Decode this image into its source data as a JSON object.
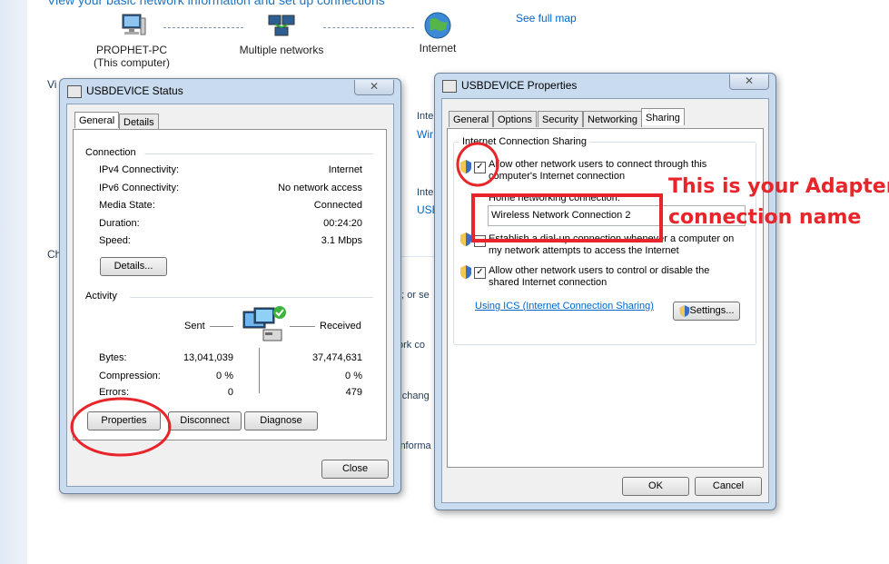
{
  "background": {
    "top_text": "View your basic network information and set up connections",
    "see_full_map": "See full map",
    "nodes": [
      {
        "name": "PROPHET-PC",
        "sub": "(This computer)"
      },
      {
        "name": "Multiple networks",
        "sub": ""
      },
      {
        "name": "Internet",
        "sub": ""
      }
    ],
    "fragments": {
      "vi": "Vi",
      "ch": "Ch",
      "inte1": "Inte",
      "wir": "Wir",
      "inte2": "Inte",
      "usb": "USB",
      "on_or_se": "n; or se",
      "ork_co": "ork co",
      "r_change": "r chang",
      "informa": "informa"
    }
  },
  "status_window": {
    "title": "USBDEVICE Status",
    "close_glyph": "✕",
    "tabs": [
      "General",
      "Details"
    ],
    "connection_label": "Connection",
    "rows": [
      {
        "label": "IPv4 Connectivity:",
        "value": "Internet"
      },
      {
        "label": "IPv6 Connectivity:",
        "value": "No network access"
      },
      {
        "label": "Media State:",
        "value": "Connected"
      },
      {
        "label": "Duration:",
        "value": "00:24:20"
      },
      {
        "label": "Speed:",
        "value": "3.1 Mbps"
      }
    ],
    "details_button": "Details...",
    "activity_label": "Activity",
    "sent_label": "Sent",
    "received_label": "Received",
    "activity_rows": [
      {
        "label": "Bytes:",
        "sent": "13,041,039",
        "received": "37,474,631"
      },
      {
        "label": "Compression:",
        "sent": "0 %",
        "received": "0 %"
      },
      {
        "label": "Errors:",
        "sent": "0",
        "received": "479"
      }
    ],
    "buttons": {
      "properties": "Properties",
      "disconnect": "Disconnect",
      "diagnose": "Diagnose",
      "close": "Close"
    }
  },
  "properties_window": {
    "title": "USBDEVICE Properties",
    "close_glyph": "✕",
    "tabs": [
      "General",
      "Options",
      "Security",
      "Networking",
      "Sharing"
    ],
    "group_label": "Internet Connection Sharing",
    "allow_connect": {
      "line1": "Allow other network users to connect through this",
      "line2": "computer's Internet connection",
      "checked": true
    },
    "home_label": "Home networking connection:",
    "home_value": "Wireless Network Connection 2",
    "dialup": {
      "line1": "Establish a dial-up connection whenever a computer on",
      "line2": "my network attempts to access the Internet",
      "checked": false
    },
    "allow_control": {
      "line1": "Allow other network users to control or disable the",
      "line2": "shared Internet connection",
      "checked": true
    },
    "ics_link": "Using ICS (Internet Connection Sharing)",
    "settings_button": "Settings...",
    "ok_button": "OK",
    "cancel_button": "Cancel",
    "check_glyph": "✓"
  },
  "annotation": {
    "line1": "This is your Adapter",
    "line2": "connection name",
    "color": "#e8252b"
  }
}
